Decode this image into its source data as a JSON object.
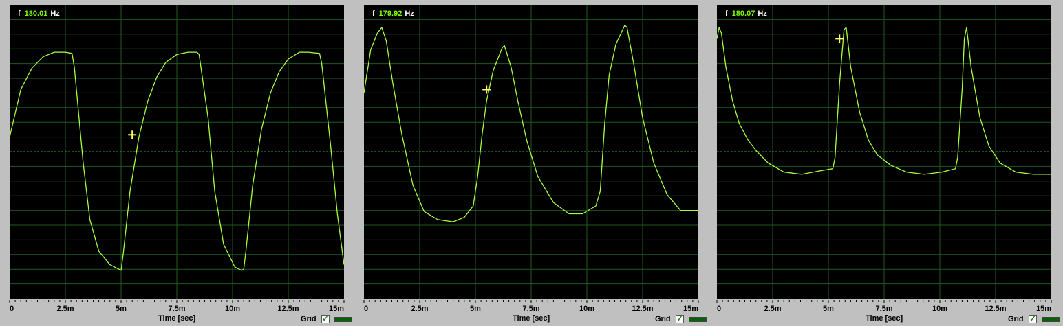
{
  "panels": [
    {
      "freq_prefix": "f",
      "freq_value": "180.01",
      "freq_unit": "Hz"
    },
    {
      "freq_prefix": "f",
      "freq_value": "179.92",
      "freq_unit": "Hz"
    },
    {
      "freq_prefix": "f",
      "freq_value": "180.07",
      "freq_unit": "Hz"
    }
  ],
  "xlabel": "Time [sec]",
  "grid_label": "Grid",
  "grid_checked": "✓",
  "colors": {
    "background": "#000000",
    "grid": "#1f5a1f",
    "trace": "#a8ff40",
    "cursor": "#ffff66",
    "frame": "#c0c0c0"
  },
  "chart_data": [
    {
      "type": "line",
      "xlabel": "Time [sec]",
      "xlim": [
        0,
        0.015
      ],
      "xticks": [
        "0",
        "2.5m",
        "5m",
        "7.5m",
        "10m",
        "12.5m",
        "15m"
      ],
      "grid": true,
      "frequency": "180.01 Hz",
      "series": [
        {
          "x": [
            0,
            0.0005,
            0.001,
            0.0015,
            0.002,
            0.0025,
            0.0028,
            0.0029,
            0.0033,
            0.0036,
            0.004,
            0.0045,
            0.0049,
            0.005,
            0.0051,
            0.0054,
            0.0058,
            0.0062,
            0.0066,
            0.007,
            0.0075,
            0.008,
            0.0084,
            0.0085,
            0.0089,
            0.0092,
            0.0096,
            0.0101,
            0.0104,
            0.0105,
            0.0106,
            0.0109,
            0.0113,
            0.0117,
            0.0121,
            0.0125,
            0.013,
            0.0134,
            0.0139,
            0.014,
            0.0144,
            0.0147,
            0.015
          ],
          "y": [
            0.13,
            0.55,
            0.74,
            0.84,
            0.88,
            0.88,
            0.87,
            0.75,
            -0.1,
            -0.6,
            -0.88,
            -1.0,
            -1.04,
            -1.05,
            -0.9,
            -0.35,
            0.13,
            0.45,
            0.66,
            0.79,
            0.86,
            0.88,
            0.88,
            0.86,
            0.3,
            -0.35,
            -0.82,
            -1.02,
            -1.05,
            -1.04,
            -0.88,
            -0.3,
            0.2,
            0.52,
            0.71,
            0.82,
            0.88,
            0.88,
            0.87,
            0.78,
            0.05,
            -0.55,
            -1.0
          ]
        }
      ],
      "cursor": {
        "x": 0.0055,
        "y": 0.15
      }
    },
    {
      "type": "line",
      "xlabel": "Time [sec]",
      "xlim": [
        0,
        0.015
      ],
      "xticks": [
        "0",
        "2.5m",
        "5m",
        "7.5m",
        "10m",
        "12.5m",
        "15m"
      ],
      "grid": true,
      "frequency": "179.92 Hz",
      "series": [
        {
          "x": [
            0,
            0.0003,
            0.0006,
            0.0008,
            0.001,
            0.0013,
            0.0017,
            0.0022,
            0.0027,
            0.0033,
            0.004,
            0.0045,
            0.0049,
            0.0051,
            0.0053,
            0.0055,
            0.0058,
            0.0062,
            0.0063,
            0.0066,
            0.0069,
            0.0073,
            0.0078,
            0.0085,
            0.0092,
            0.0098,
            0.0104,
            0.0106,
            0.0108,
            0.011,
            0.0113,
            0.0117,
            0.0118,
            0.0121,
            0.0125,
            0.013,
            0.0136,
            0.0142,
            0.015
          ],
          "y": [
            0.52,
            0.9,
            1.05,
            1.1,
            0.98,
            0.6,
            0.15,
            -0.3,
            -0.53,
            -0.6,
            -0.62,
            -0.58,
            -0.48,
            -0.22,
            0.15,
            0.45,
            0.72,
            0.92,
            0.94,
            0.75,
            0.45,
            0.1,
            -0.22,
            -0.45,
            -0.55,
            -0.55,
            -0.48,
            -0.35,
            0.25,
            0.68,
            0.95,
            1.12,
            1.1,
            0.78,
            0.3,
            -0.1,
            -0.38,
            -0.52,
            -0.52
          ]
        }
      ],
      "cursor": {
        "x": 0.0055,
        "y": 0.55
      }
    },
    {
      "type": "line",
      "xlabel": "Time [sec]",
      "xlim": [
        0,
        0.015
      ],
      "xticks": [
        "0",
        "2.5m",
        "5m",
        "7.5m",
        "10m",
        "12.5m",
        "15m"
      ],
      "grid": true,
      "frequency": "180.07 Hz",
      "series": [
        {
          "x": [
            0,
            0.0001,
            0.0002,
            0.0004,
            0.0007,
            0.001,
            0.0014,
            0.0018,
            0.0023,
            0.003,
            0.0038,
            0.0046,
            0.0052,
            0.0053,
            0.0055,
            0.0057,
            0.0058,
            0.006,
            0.0064,
            0.0068,
            0.0072,
            0.0078,
            0.0085,
            0.0093,
            0.0101,
            0.0107,
            0.0108,
            0.011,
            0.0111,
            0.0112,
            0.0114,
            0.0118,
            0.0122,
            0.0127,
            0.0134,
            0.0142,
            0.015
          ],
          "y": [
            1.0,
            1.1,
            1.05,
            0.75,
            0.45,
            0.25,
            0.1,
            0.0,
            -0.1,
            -0.18,
            -0.2,
            -0.17,
            -0.15,
            -0.05,
            0.6,
            1.08,
            1.1,
            0.75,
            0.35,
            0.1,
            -0.03,
            -0.12,
            -0.18,
            -0.2,
            -0.18,
            -0.15,
            -0.05,
            0.55,
            1.0,
            1.1,
            0.75,
            0.3,
            0.05,
            -0.1,
            -0.18,
            -0.2,
            -0.2
          ]
        }
      ],
      "cursor": {
        "x": 0.0055,
        "y": 1.0
      }
    }
  ]
}
